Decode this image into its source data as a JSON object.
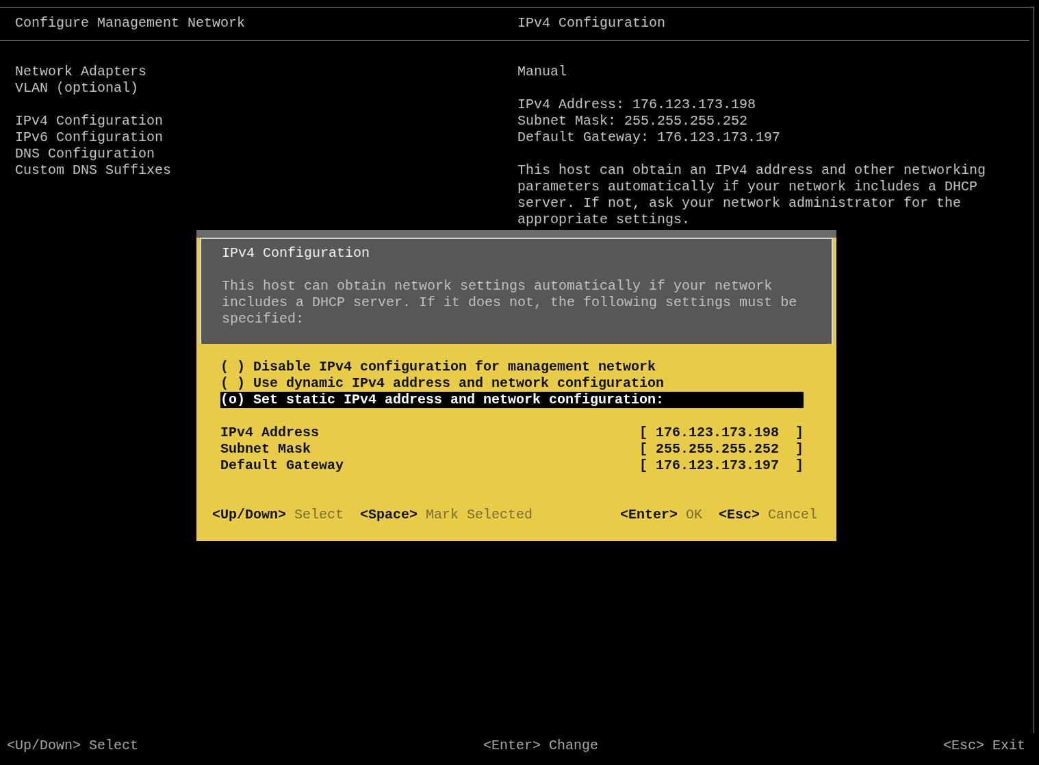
{
  "header": {
    "left_title": "Configure Management Network",
    "right_title": "IPv4 Configuration"
  },
  "menu_groups": [
    [
      "Network Adapters",
      "VLAN (optional)"
    ],
    [
      "IPv4 Configuration",
      "IPv6 Configuration",
      "DNS Configuration",
      "Custom DNS Suffixes"
    ]
  ],
  "details": {
    "mode": "Manual",
    "lines": [
      "IPv4 Address: 176.123.173.198",
      "Subnet Mask: 255.255.255.252",
      "Default Gateway: 176.123.173.197"
    ],
    "description": "This host can obtain an IPv4 address and other networking parameters automatically if your network includes a DHCP server. If not, ask your network administrator for the appropriate settings."
  },
  "dialog": {
    "title": "IPv4 Configuration",
    "description": "This host can obtain network settings automatically if your network includes a DHCP server. If it does not, the following settings must be specified:",
    "options": [
      {
        "marker": "( )",
        "label": "Disable IPv4 configuration for management network",
        "selected": false
      },
      {
        "marker": "( )",
        "label": "Use dynamic IPv4 address and network configuration",
        "selected": false
      },
      {
        "marker": "(o)",
        "label": "Set static IPv4 address and network configuration:",
        "selected": true
      }
    ],
    "fields": [
      {
        "label": "IPv4 Address",
        "value": "[ 176.123.173.198  ]"
      },
      {
        "label": "Subnet Mask",
        "value": "[ 255.255.255.252  ]"
      },
      {
        "label": "Default Gateway",
        "value": "[ 176.123.173.197  ]"
      }
    ],
    "hints_left": [
      {
        "key": "<Up/Down>",
        "action": "Select"
      },
      {
        "key": "<Space>",
        "action": "Mark Selected"
      }
    ],
    "hints_right": [
      {
        "key": "<Enter>",
        "action": "OK"
      },
      {
        "key": "<Esc>",
        "action": "Cancel"
      }
    ]
  },
  "footer": [
    {
      "key": "<Up/Down>",
      "action": "Select"
    },
    {
      "key": "<Enter>",
      "action": "Change"
    },
    {
      "key": "<Esc>",
      "action": "Exit"
    }
  ]
}
